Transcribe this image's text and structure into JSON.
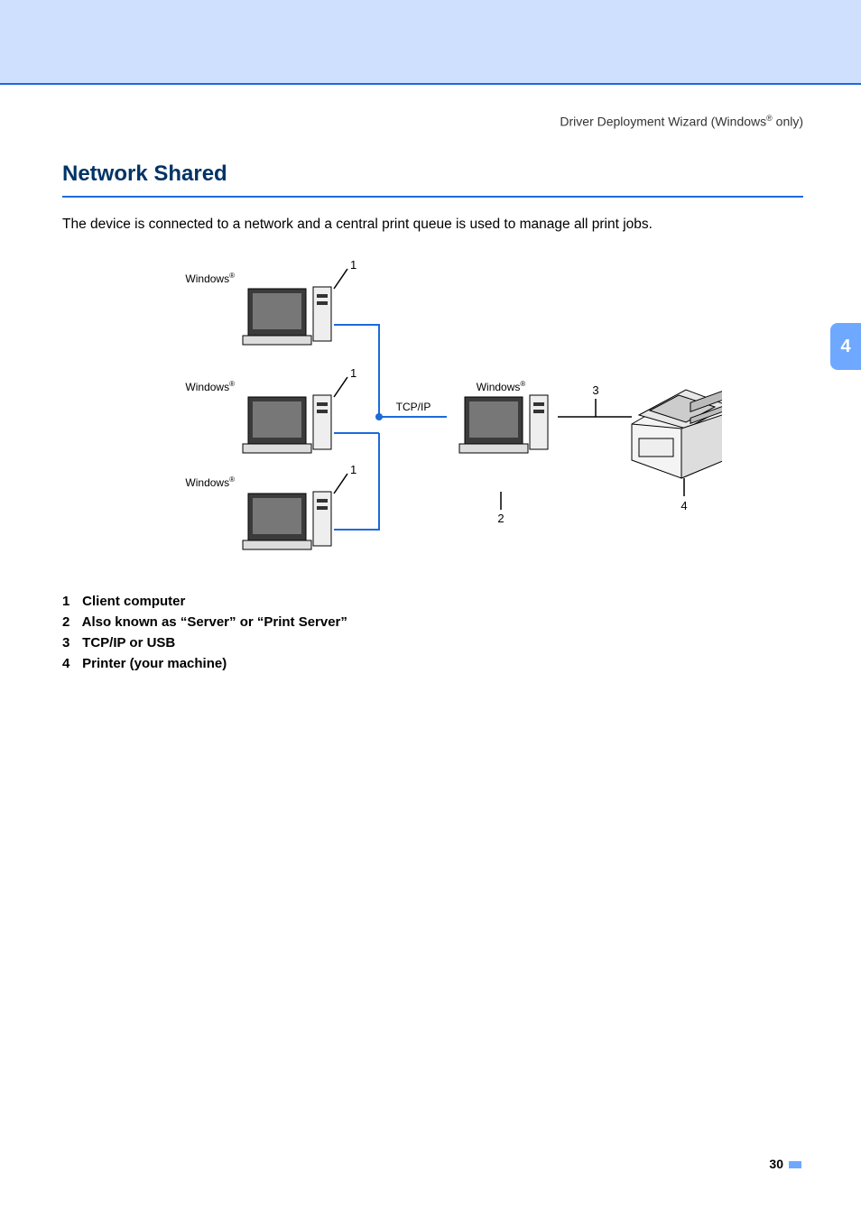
{
  "header": {
    "running_head_prefix": "Driver Deployment Wizard (Windows",
    "running_head_suffix": " only)",
    "reg_mark": "®"
  },
  "side_tab": "4",
  "section": {
    "title": "Network Shared",
    "body": "The device is connected to a network and a central print queue is used to manage all print jobs."
  },
  "diagram": {
    "client_label_prefix": "Windows",
    "reg_mark": "®",
    "server_label_prefix": "Windows",
    "protocol": "TCP/IP",
    "callout1": "1",
    "callout2": "2",
    "callout3": "3",
    "callout4": "4"
  },
  "legend": {
    "items": [
      {
        "num": "1",
        "text": "Client computer"
      },
      {
        "num": "2",
        "text": "Also known as “Server” or “Print Server”"
      },
      {
        "num": "3",
        "text": "TCP/IP or USB"
      },
      {
        "num": "4",
        "text": "Printer (your machine)"
      }
    ]
  },
  "page_number": "30"
}
